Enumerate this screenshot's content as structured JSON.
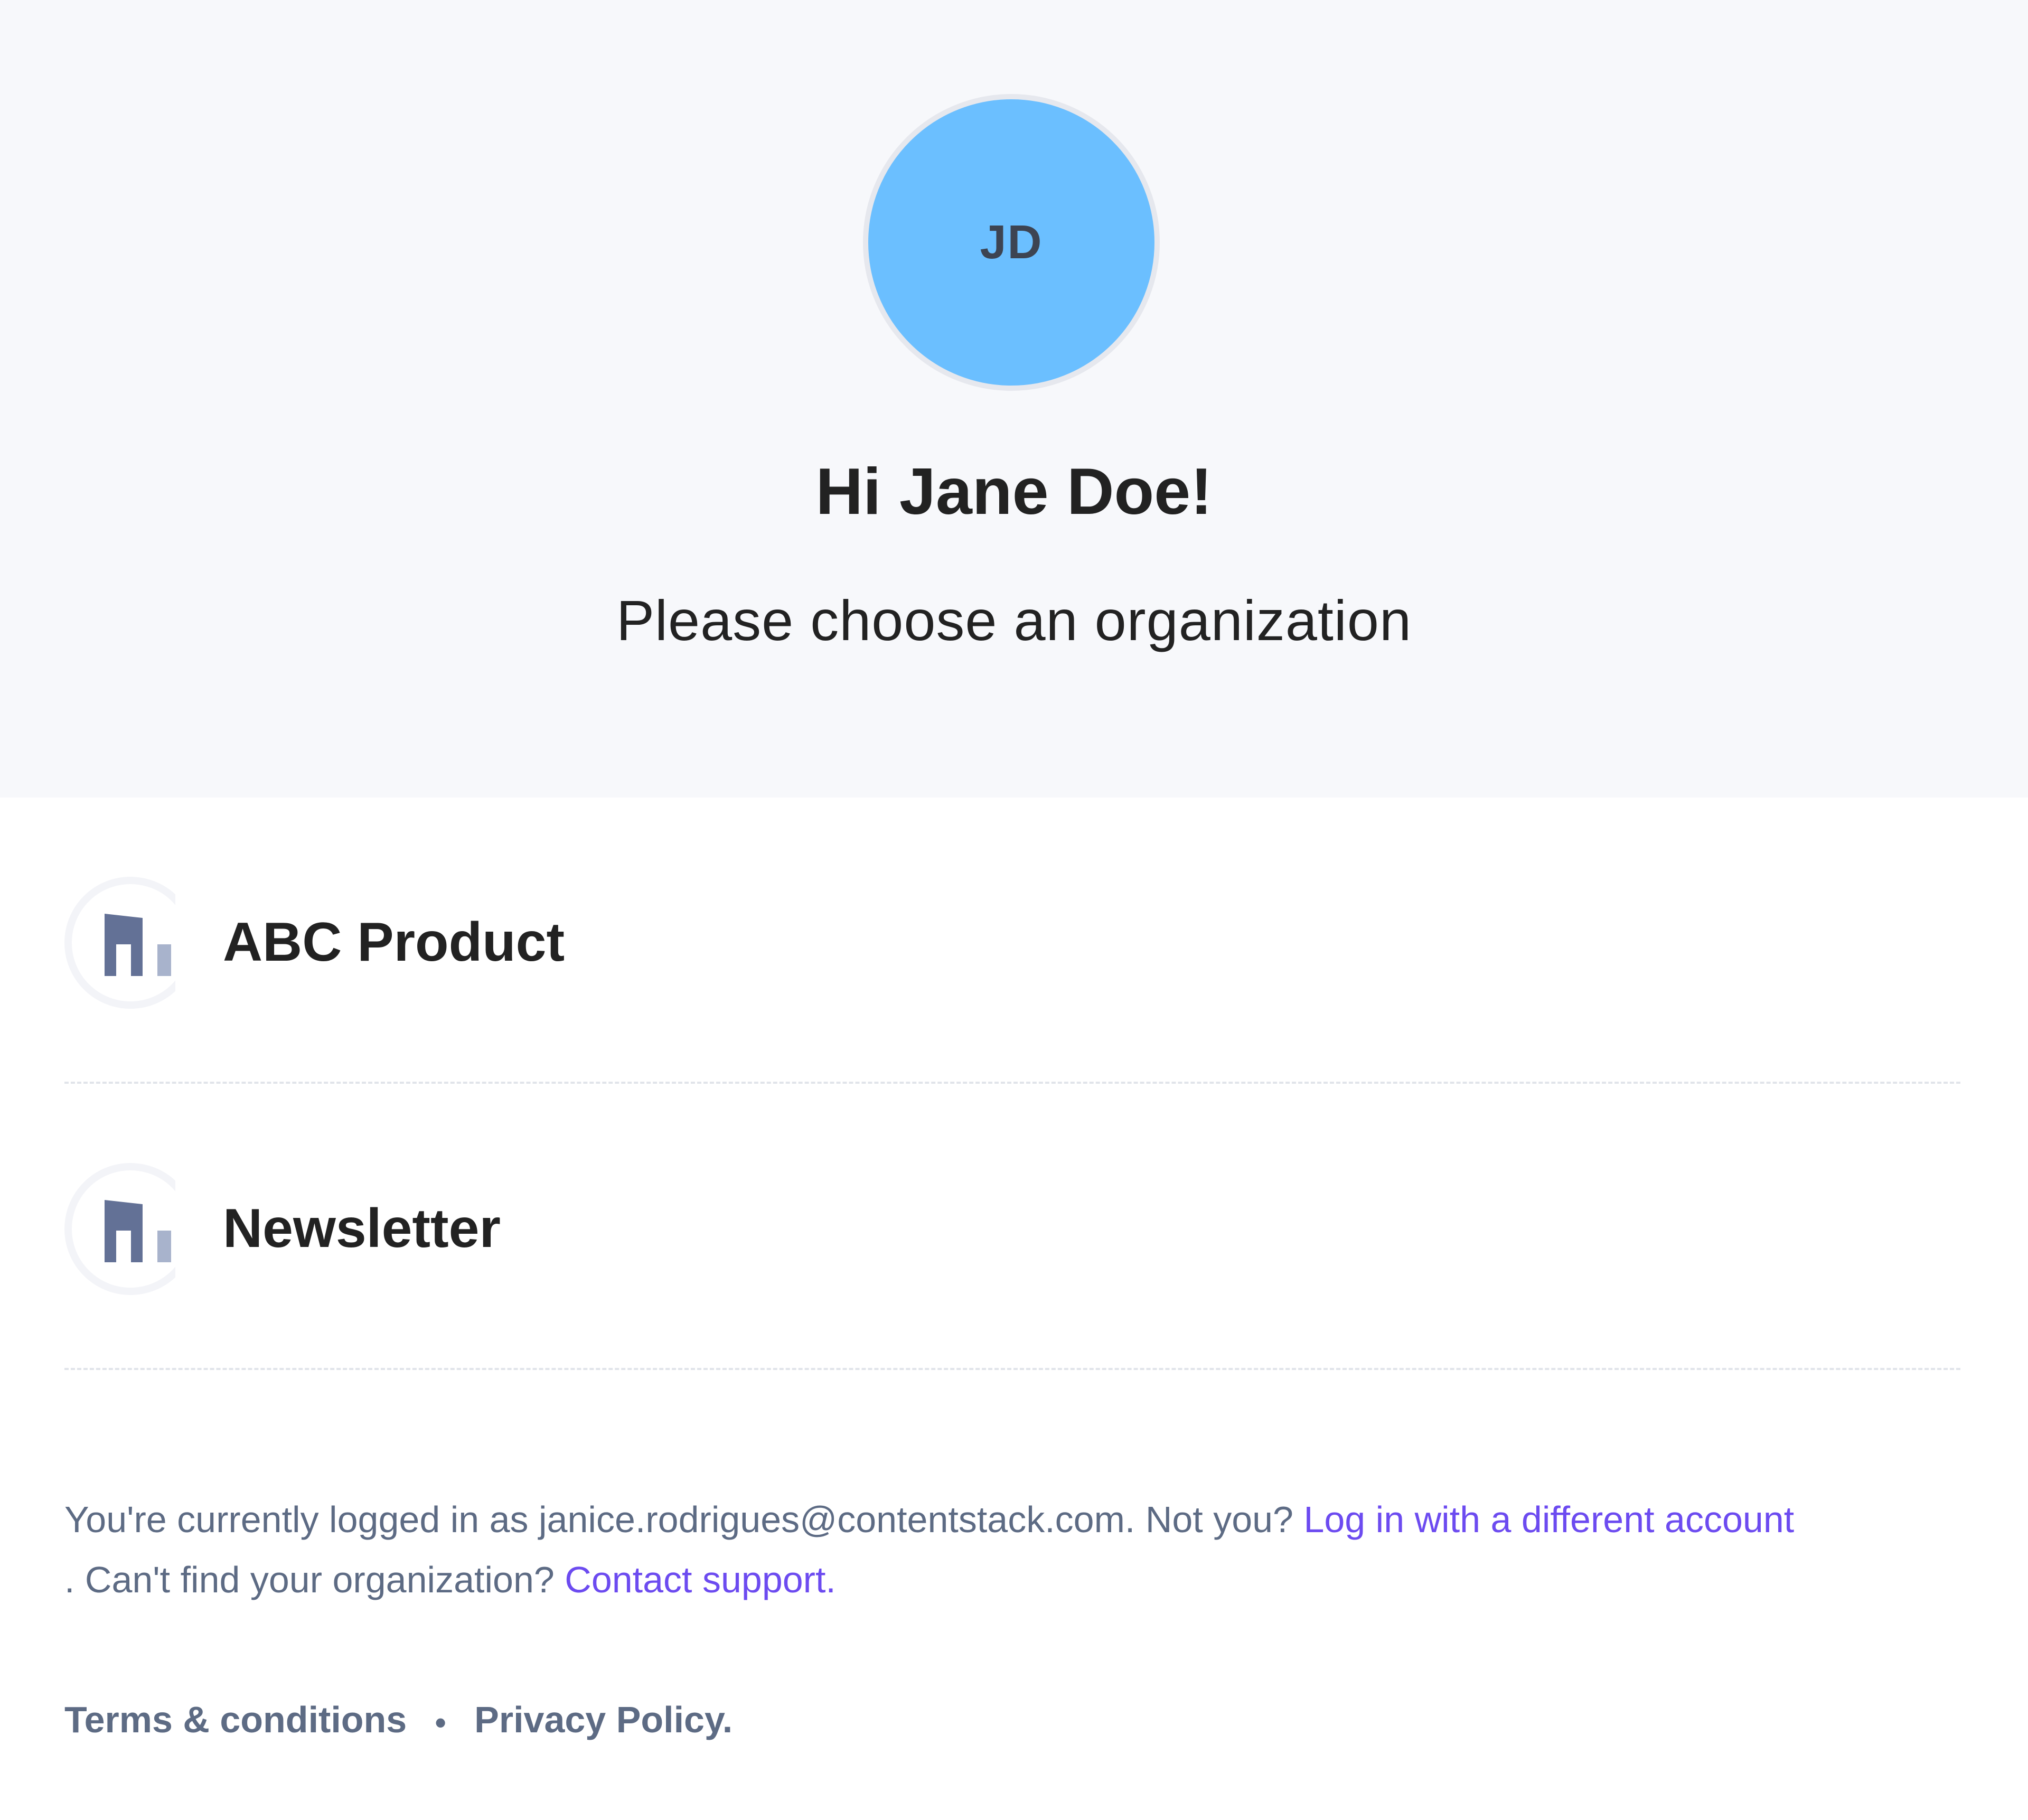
{
  "user": {
    "initials": "JD",
    "greeting": "Hi Jane Doe!",
    "prompt": "Please choose an organization"
  },
  "organizations": [
    {
      "name": "ABC Product",
      "icon": "organization-building-icon"
    },
    {
      "name": "Newsletter",
      "icon": "organization-building-icon"
    }
  ],
  "footer": {
    "logged_in_prefix": "You're currently logged in as janice.rodrigues@contentstack.com. Not you? ",
    "different_account_link": "Log in with a different account",
    "cant_find": ". Can't find your organization? ",
    "contact_support_link": "Contact support.",
    "terms_link": "Terms & conditions",
    "separator": "•",
    "privacy_link": "Privacy Policy",
    "privacy_suffix": "."
  },
  "colors": {
    "avatar_bg": "#6bbfff",
    "link": "#6c4bf0",
    "header_bg": "#f7f8fb",
    "icon": "#637196"
  }
}
